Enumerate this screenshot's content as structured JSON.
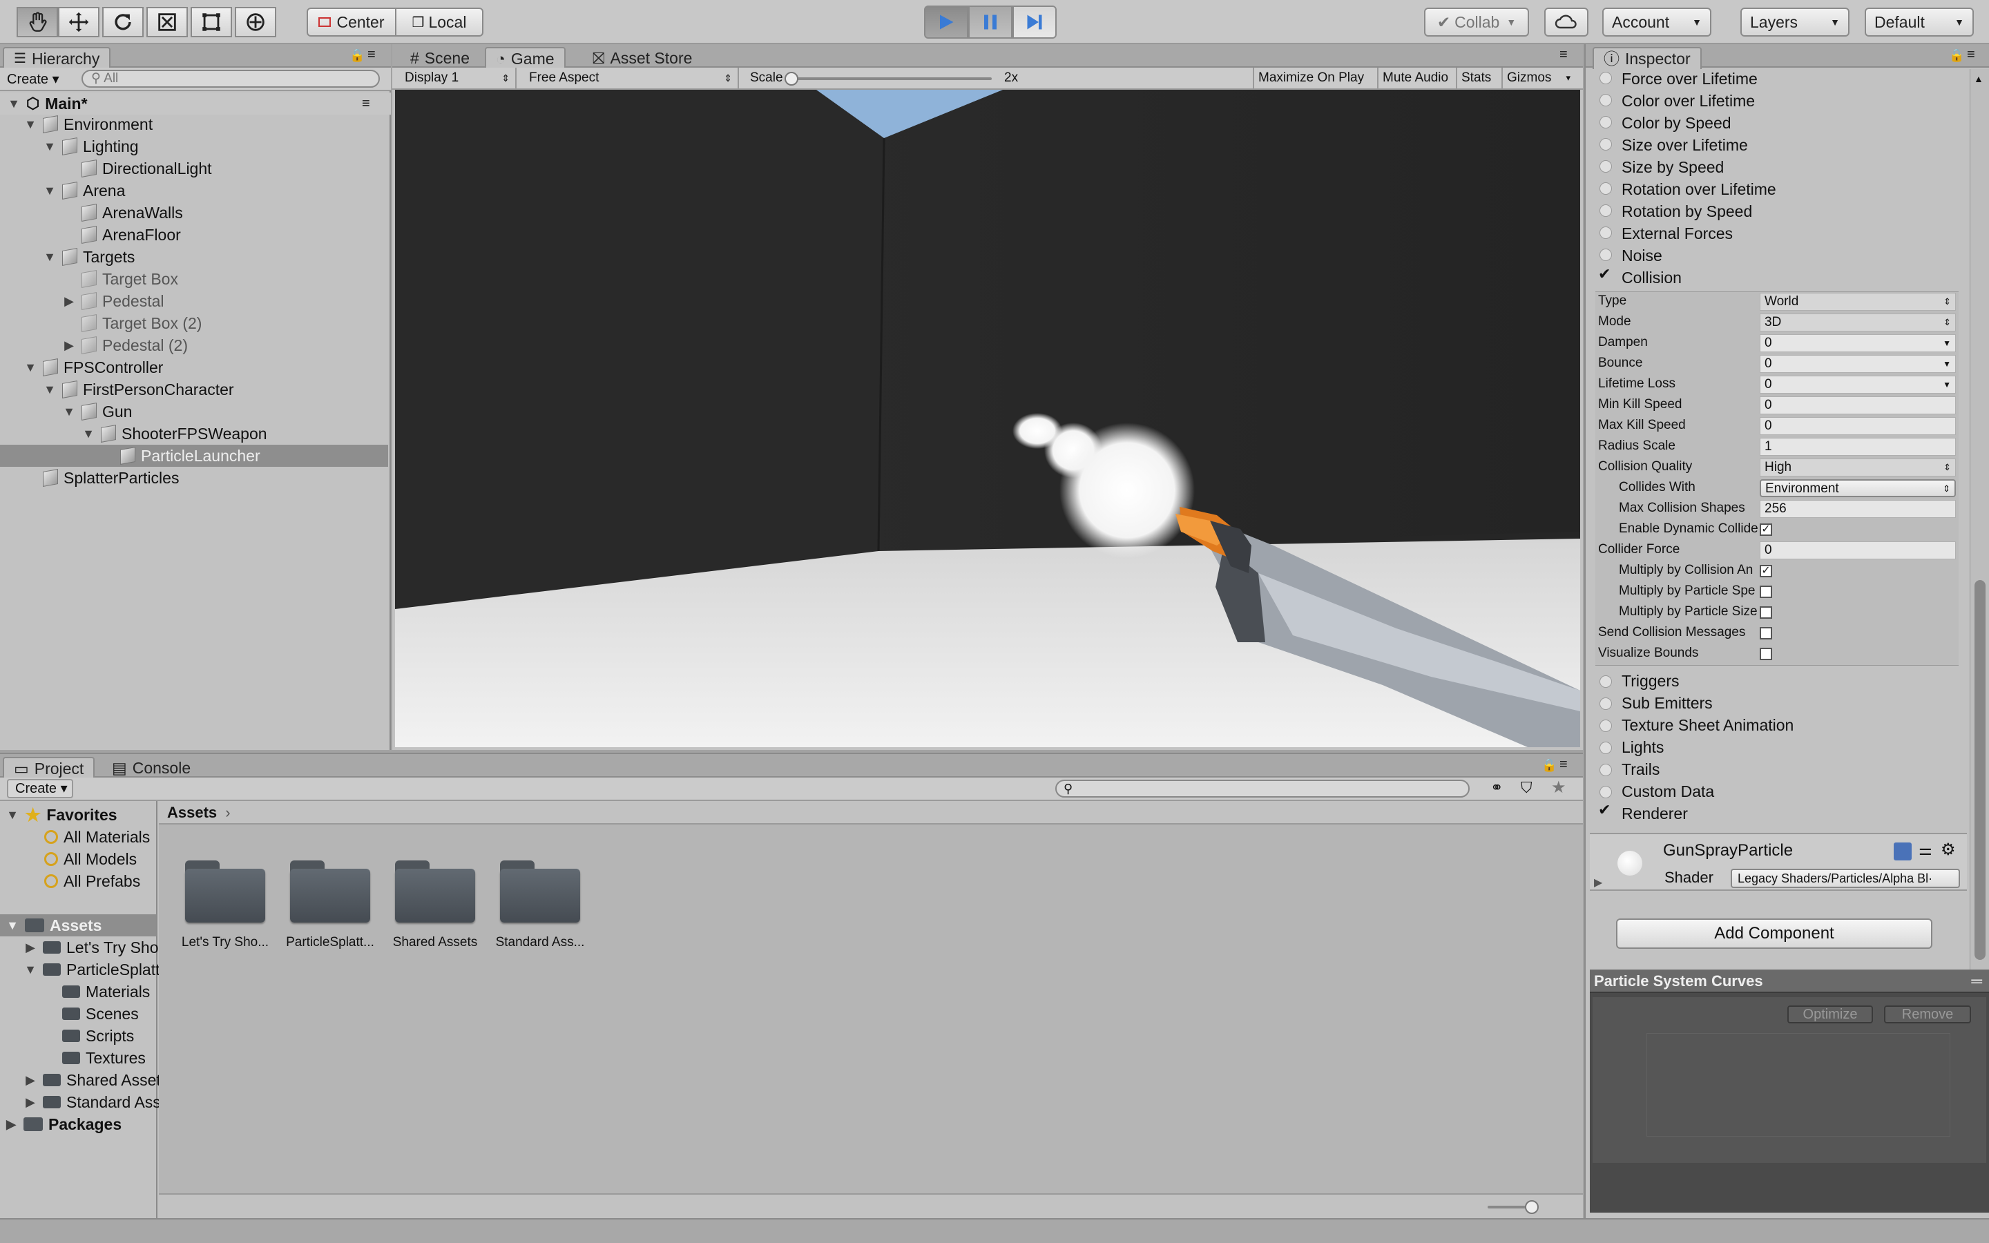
{
  "toolbar": {
    "center_label": "Center",
    "local_label": "Local",
    "collab_label": "Collab",
    "account_label": "Account",
    "layers_label": "Layers",
    "layout_label": "Default"
  },
  "hierarchy": {
    "tab": "Hierarchy",
    "create_label": "Create",
    "search_placeholder": "All",
    "scene_name": "Main*",
    "items": [
      {
        "label": "Environment"
      },
      {
        "label": "Lighting"
      },
      {
        "label": "DirectionalLight"
      },
      {
        "label": "Arena"
      },
      {
        "label": "ArenaWalls"
      },
      {
        "label": "ArenaFloor"
      },
      {
        "label": "Targets"
      },
      {
        "label": "Target Box"
      },
      {
        "label": "Pedestal"
      },
      {
        "label": "Target Box (2)"
      },
      {
        "label": "Pedestal (2)"
      },
      {
        "label": "FPSController"
      },
      {
        "label": "FirstPersonCharacter"
      },
      {
        "label": "Gun"
      },
      {
        "label": "ShooterFPSWeapon"
      },
      {
        "label": "ParticleLauncher"
      },
      {
        "label": "SplatterParticles"
      }
    ]
  },
  "center_tabs": {
    "scene": "Scene",
    "game": "Game",
    "asset_store": "Asset Store"
  },
  "game_bar": {
    "display": "Display 1",
    "aspect": "Free Aspect",
    "scale_label": "Scale",
    "scale_value": "2x",
    "scale_fraction": 0.0,
    "maximize": "Maximize On Play",
    "mute": "Mute Audio",
    "stats": "Stats",
    "gizmos": "Gizmos"
  },
  "inspector": {
    "tab": "Inspector",
    "modules_top": [
      "Force over Lifetime",
      "Color over Lifetime",
      "Color by Speed",
      "Size over Lifetime",
      "Size by Speed",
      "Rotation over Lifetime",
      "Rotation by Speed",
      "External Forces",
      "Noise",
      "Collision"
    ],
    "collision": {
      "type_label": "Type",
      "type_value": "World",
      "mode_label": "Mode",
      "mode_value": "3D",
      "dampen_label": "Dampen",
      "dampen_value": "0",
      "bounce_label": "Bounce",
      "bounce_value": "0",
      "lifetime_loss_label": "Lifetime Loss",
      "lifetime_loss_value": "0",
      "min_kill_label": "Min Kill Speed",
      "min_kill_value": "0",
      "max_kill_label": "Max Kill Speed",
      "max_kill_value": "0",
      "radius_label": "Radius Scale",
      "radius_value": "1",
      "quality_label": "Collision Quality",
      "quality_value": "High",
      "collides_label": "Collides With",
      "collides_value": "Environment",
      "max_shapes_label": "Max Collision Shapes",
      "max_shapes_value": "256",
      "dynamic_label": "Enable Dynamic Collide",
      "collider_force_label": "Collider Force",
      "collider_force_value": "0",
      "mult_angle_label": "Multiply by Collision An",
      "mult_speed_label": "Multiply by Particle Spe",
      "mult_size_label": "Multiply by Particle Size",
      "send_msg_label": "Send Collision Messages",
      "vis_bounds_label": "Visualize Bounds"
    },
    "modules_bottom": [
      "Triggers",
      "Sub Emitters",
      "Texture Sheet Animation",
      "Lights",
      "Trails",
      "Custom Data",
      "Renderer"
    ],
    "material_name": "GunSprayParticle",
    "shader_label": "Shader",
    "shader_value": "Legacy Shaders/Particles/Alpha Bl·",
    "add_component": "Add Component",
    "curves_title": "Particle System Curves",
    "optimize": "Optimize",
    "remove": "Remove"
  },
  "project": {
    "tab_project": "Project",
    "tab_console": "Console",
    "create_label": "Create",
    "favorites": "Favorites",
    "fav_items": [
      "All Materials",
      "All Models",
      "All Prefabs"
    ],
    "assets_label": "Assets",
    "breadcrumb": "Assets",
    "tree": [
      "Let's Try Sho",
      "ParticleSplatt",
      "Materials",
      "Scenes",
      "Scripts",
      "Textures",
      "Shared Asset",
      "Standard Ass"
    ],
    "packages": "Packages",
    "folders": [
      "Let's Try Sho...",
      "ParticleSplatt...",
      "Shared Assets",
      "Standard Ass..."
    ]
  },
  "colors": {
    "accent_play": "#3a7bd5",
    "toolbar_bg": "#c8c8c8",
    "panel_bg": "#c2c2c2"
  }
}
